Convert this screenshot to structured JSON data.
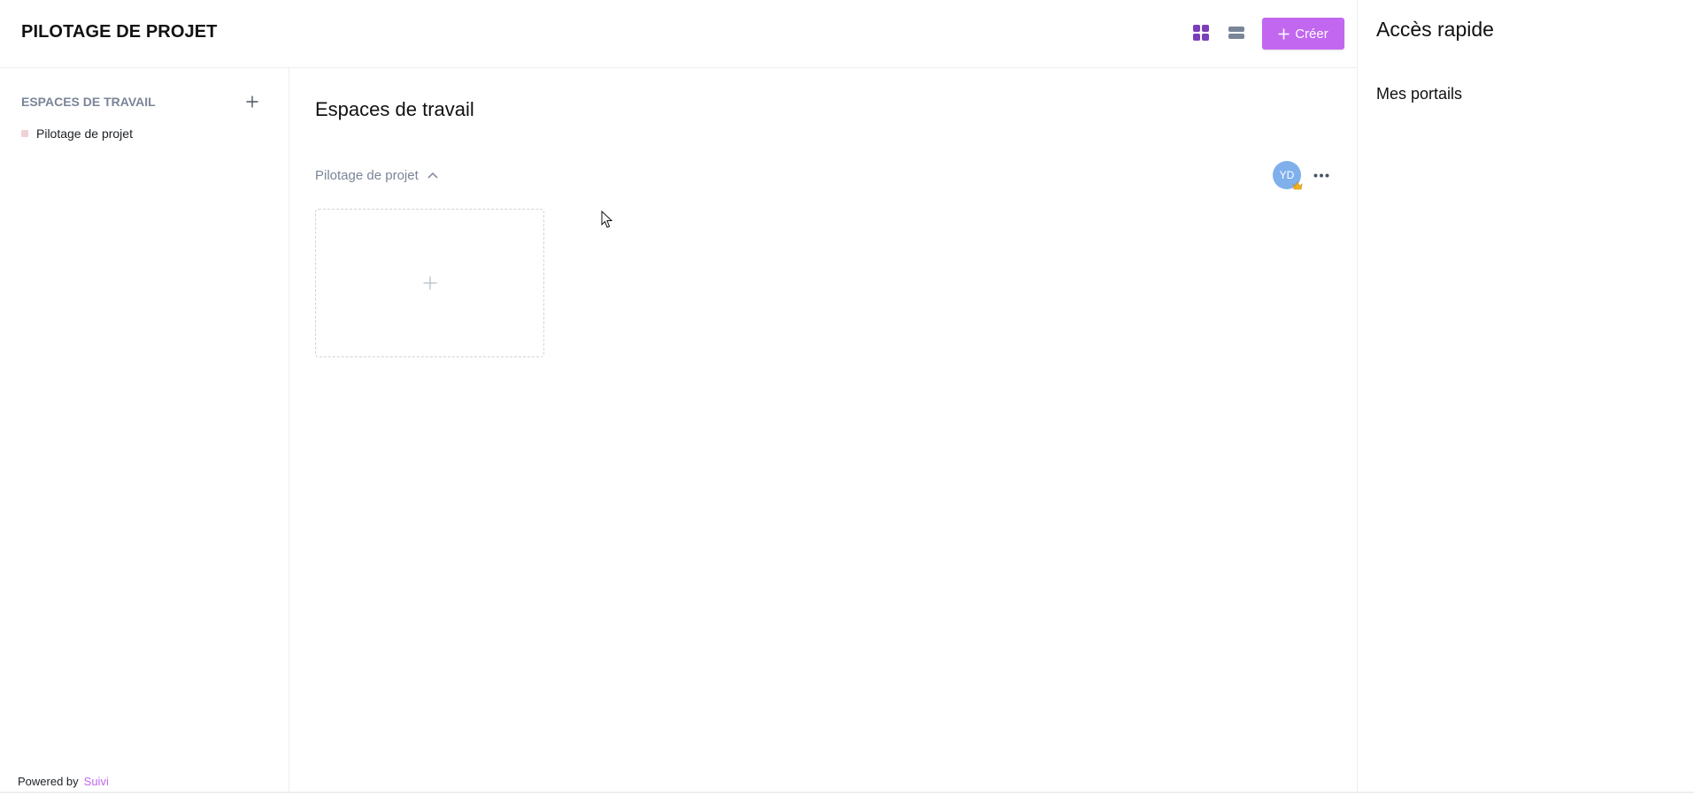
{
  "header": {
    "title": "PILOTAGE DE PROJET",
    "create_label": "Créer",
    "grid_view_icon": "grid-view-icon",
    "list_view_icon": "list-view-icon"
  },
  "sidebar": {
    "heading": "ESPACES DE TRAVAIL",
    "add_icon": "plus-icon",
    "items": [
      {
        "label": "Pilotage de projet",
        "color": "#eed2d6"
      }
    ],
    "powered_by": "Powered by",
    "brand": "Suivi"
  },
  "main": {
    "title": "Espaces de travail",
    "workspace": {
      "name": "Pilotage de projet",
      "avatar_initials": "YD",
      "more_icon": "more-horizontal-icon"
    }
  },
  "right_panel": {
    "title": "Accès rapide",
    "subtitle": "Mes portails"
  },
  "colors": {
    "accent": "#c267f0",
    "grid_icon_active": "#7b3fb8",
    "avatar_bg": "#7fb0ec",
    "muted_text": "#7a8597"
  }
}
